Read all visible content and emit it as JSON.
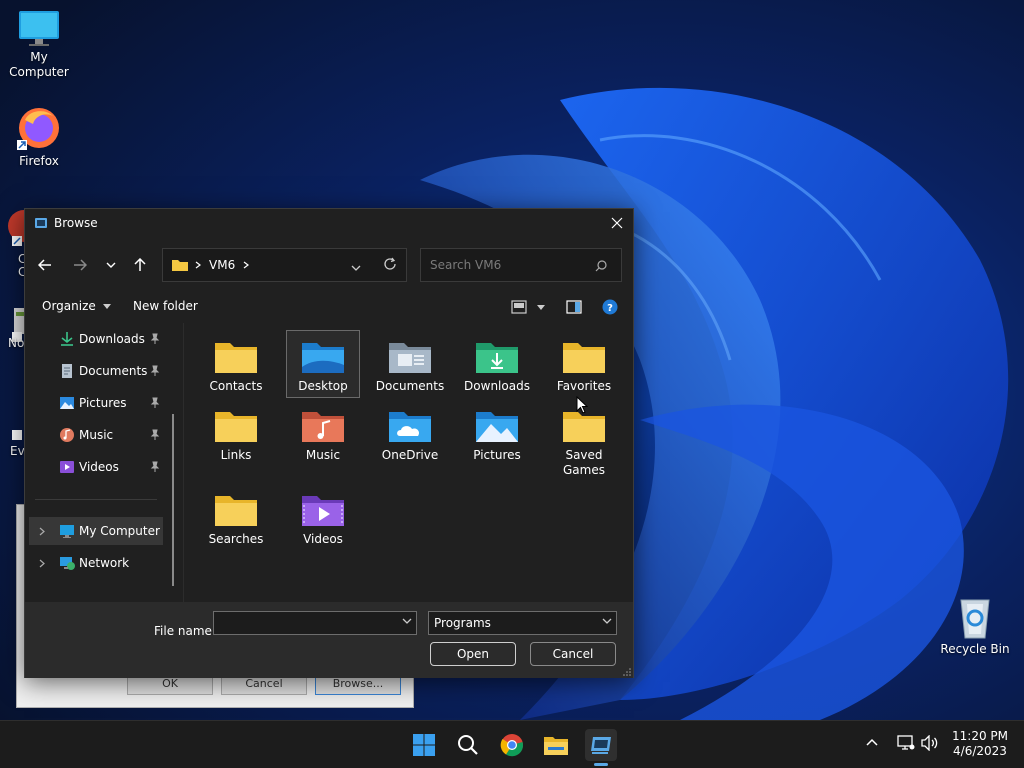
{
  "desktop": {
    "icons": [
      {
        "label": "My Computer",
        "icon": "monitor-icon"
      },
      {
        "label": "Firefox",
        "icon": "firefox-icon"
      },
      {
        "label": "Recycle Bin",
        "icon": "recycle-bin-icon"
      }
    ],
    "partial_labels": [
      "C",
      "C",
      "No",
      "Ev"
    ]
  },
  "background_dialog": {
    "buttons": [
      "OK",
      "Cancel",
      "Browse..."
    ]
  },
  "dialog": {
    "title": "Browse",
    "address": {
      "crumbs": [
        "VM6"
      ]
    },
    "search_placeholder": "Search VM6",
    "toolbar": {
      "organize": "Organize",
      "new_folder": "New folder"
    },
    "nav": {
      "pinned": [
        {
          "label": "Downloads",
          "icon": "download-icon"
        },
        {
          "label": "Documents",
          "icon": "document-icon"
        },
        {
          "label": "Pictures",
          "icon": "pictures-icon"
        },
        {
          "label": "Music",
          "icon": "music-icon"
        },
        {
          "label": "Videos",
          "icon": "videos-icon"
        }
      ],
      "tree": [
        {
          "label": "My Computer",
          "icon": "monitor-icon",
          "selected": true
        },
        {
          "label": "Network",
          "icon": "network-icon",
          "selected": false
        }
      ]
    },
    "files": [
      {
        "label": "Contacts",
        "icon": "folder-icon"
      },
      {
        "label": "Desktop",
        "icon": "desktop-folder-icon",
        "selected": true
      },
      {
        "label": "Documents",
        "icon": "documents-folder-icon"
      },
      {
        "label": "Downloads",
        "icon": "downloads-folder-icon"
      },
      {
        "label": "Favorites",
        "icon": "folder-icon"
      },
      {
        "label": "Links",
        "icon": "folder-icon"
      },
      {
        "label": "Music",
        "icon": "music-folder-icon"
      },
      {
        "label": "OneDrive",
        "icon": "onedrive-folder-icon"
      },
      {
        "label": "Pictures",
        "icon": "pictures-folder-icon"
      },
      {
        "label": "Saved Games",
        "icon": "folder-icon"
      },
      {
        "label": "Searches",
        "icon": "folder-icon"
      },
      {
        "label": "Videos",
        "icon": "videos-folder-icon"
      }
    ],
    "file_name_label": "File name:",
    "file_name_value": "",
    "file_type": "Programs",
    "open_label": "Open",
    "cancel_label": "Cancel"
  },
  "taskbar": {
    "apps": [
      "start-icon",
      "search-icon",
      "chrome-icon",
      "file-explorer-icon",
      "active-app-icon"
    ],
    "clock": {
      "time": "11:20 PM",
      "date": "4/6/2023"
    }
  },
  "colors": {
    "accent": "#3a86d6",
    "dialog_bg": "#202020",
    "folder_yellow": "#f5c842"
  }
}
